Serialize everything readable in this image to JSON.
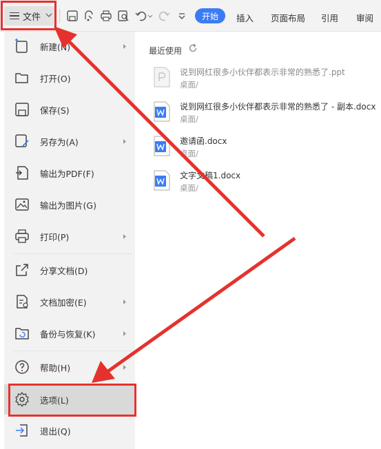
{
  "toolbar": {
    "file_label": "文件",
    "tab_start": "开始",
    "tab_insert": "插入",
    "tab_layout": "页面布局",
    "tab_references": "引用",
    "tab_review": "审阅"
  },
  "menu": {
    "items": [
      {
        "label": "新建(N)",
        "icon": "new-doc-icon"
      },
      {
        "label": "打开(O)",
        "icon": "folder-icon"
      },
      {
        "label": "保存(S)",
        "icon": "save-icon"
      },
      {
        "label": "另存为(A)",
        "icon": "save-as-icon"
      },
      {
        "label": "输出为PDF(F)",
        "icon": "pdf-icon"
      },
      {
        "label": "输出为图片(G)",
        "icon": "image-icon"
      },
      {
        "label": "打印(P)",
        "icon": "printer-icon"
      },
      {
        "label": "分享文档(D)",
        "icon": "share-icon"
      },
      {
        "label": "文档加密(E)",
        "icon": "encrypt-icon"
      },
      {
        "label": "备份与恢复(K)",
        "icon": "backup-icon"
      },
      {
        "label": "帮助(H)",
        "icon": "help-icon"
      },
      {
        "label": "选项(L)",
        "icon": "gear-icon"
      },
      {
        "label": "退出(Q)",
        "icon": "exit-icon"
      }
    ]
  },
  "recent": {
    "title": "最近使用",
    "files": [
      {
        "name": "说到网红很多小伙伴都表示非常的熟悉了.ppt",
        "path": "桌面/"
      },
      {
        "name": "说到网红很多小伙伴都表示非常的熟悉了 - 副本.docx",
        "path": "桌面/"
      },
      {
        "name": "邀请函.docx",
        "path": "桌面/"
      },
      {
        "name": "文字文稿1.docx",
        "path": "桌面/"
      }
    ]
  },
  "colors": {
    "accent": "#3b7cf4",
    "annotation": "#e5322e",
    "word_icon": "#3b7cf4"
  }
}
